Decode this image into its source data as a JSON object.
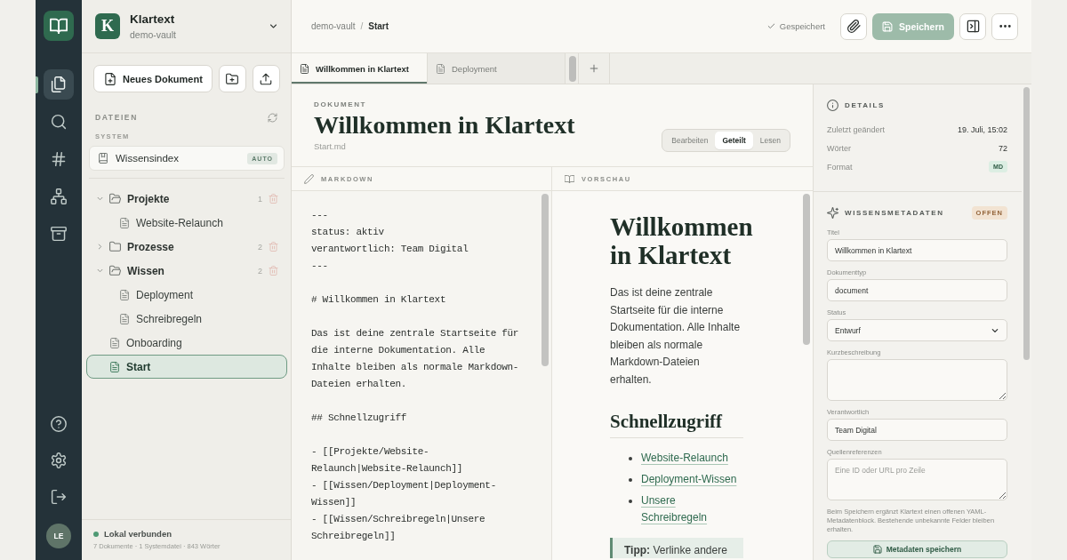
{
  "rail": {
    "nav": [
      {
        "selected": true
      },
      {
        "selected": false
      },
      {
        "selected": false
      },
      {
        "selected": false
      },
      {
        "selected": false
      }
    ],
    "avatar": "LE"
  },
  "vault": {
    "logo": "K",
    "name": "Klartext",
    "subtitle": "demo-vault"
  },
  "sidebar": {
    "new_document_button": "Neues Dokument",
    "section_label": "DATEIEN",
    "system_label": "SYSTEM",
    "system_item": {
      "label": "Wissensindex",
      "badge": "AUTO"
    },
    "tree": [
      {
        "kind": "folder",
        "label": "Projekte",
        "count": "1",
        "expanded": true,
        "selected": false,
        "children": [
          {
            "kind": "file",
            "label": "Website-Relaunch",
            "selected": false
          }
        ]
      },
      {
        "kind": "folder",
        "label": "Prozesse",
        "count": "2",
        "expanded": false,
        "selected": false
      },
      {
        "kind": "folder",
        "label": "Wissen",
        "count": "2",
        "expanded": true,
        "selected": false,
        "children": [
          {
            "kind": "file",
            "label": "Deployment",
            "selected": false
          },
          {
            "kind": "file",
            "label": "Schreibregeln",
            "selected": false
          }
        ]
      },
      {
        "kind": "file",
        "label": "Onboarding",
        "selected": false
      },
      {
        "kind": "file",
        "label": "Start",
        "selected": true
      }
    ],
    "status": {
      "connected": true,
      "label": "Lokal verbunden",
      "stats": "7 Dokumente · 1 Systemdatei · 843 Wörter"
    }
  },
  "topbar": {
    "breadcrumb": [
      "demo-vault",
      "Start"
    ],
    "separator": "/",
    "save_state": "Gespeichert",
    "save_button": {
      "label": "Speichern",
      "disabled": true
    }
  },
  "tabs": [
    {
      "label": "Willkommen in Klartext",
      "selected": true
    },
    {
      "label": "Deployment",
      "selected": false
    }
  ],
  "document": {
    "eyebrow": "DOKUMENT",
    "title": "Willkommen in Klartext",
    "filename": "Start.md",
    "view_modes": [
      {
        "label": "Bearbeiten",
        "selected": false
      },
      {
        "label": "Geteilt",
        "selected": true
      },
      {
        "label": "Lesen",
        "selected": false
      }
    ]
  },
  "editor": {
    "heading": "MARKDOWN",
    "text": "---\nstatus: aktiv\nverantwortlich: Team Digital\n---\n\n# Willkommen in Klartext\n\nDas ist deine zentrale Startseite für\ndie interne Dokumentation. Alle\nInhalte bleiben als normale Markdown-\nDateien erhalten.\n\n## Schnellzugriff\n\n- [[Projekte/Website-\nRelaunch|Website-Relaunch]]\n- [[Wissen/Deployment|Deployment-\nWissen]]\n- [[Wissen/Schreibregeln|Unsere\nSchreibregeln]]"
  },
  "preview": {
    "heading": "VORSCHAU",
    "title": "Willkommen in Klartext",
    "paragraph": "Das ist deine zentrale Startseite für die interne Dokumentation. Alle Inhalte bleiben als normale Markdown-Dateien erhalten.",
    "subheading": "Schnellzugriff",
    "links": [
      "Website-Relaunch",
      "Deployment-Wissen",
      "Unsere Schreibregeln"
    ],
    "tip": "**Tipp:** Verlinke andere"
  },
  "details": {
    "heading": "DETAILS",
    "rows": [
      {
        "kind": "text",
        "label": "Zuletzt geändert",
        "value": "19. Juli, 15:02"
      },
      {
        "kind": "text",
        "label": "Wörter",
        "value": "72"
      },
      {
        "kind": "badge",
        "label": "Format",
        "value": "MD"
      }
    ]
  },
  "metadata": {
    "heading": "WISSENSMETADATEN",
    "badge": "OFFEN",
    "fields": [
      {
        "kind": "input",
        "label": "Titel",
        "value": "Willkommen in Klartext"
      },
      {
        "kind": "input",
        "label": "Dokumenttyp",
        "value": "document"
      },
      {
        "kind": "select",
        "label": "Status",
        "value": "Entwurf"
      },
      {
        "kind": "textarea",
        "label": "Kurzbeschreibung"
      },
      {
        "kind": "input",
        "label": "Verantwortlich",
        "value": "Team Digital"
      },
      {
        "kind": "textarea",
        "label": "Quellenreferenzen",
        "placeholder": "Eine ID oder URL pro Zeile"
      }
    ],
    "note": "Beim Speichern ergänzt Klartext einen offenen YAML-Metadatenblock. Bestehende unbekannte Felder bleiben erhalten.",
    "save_button": "Metadaten speichern"
  }
}
